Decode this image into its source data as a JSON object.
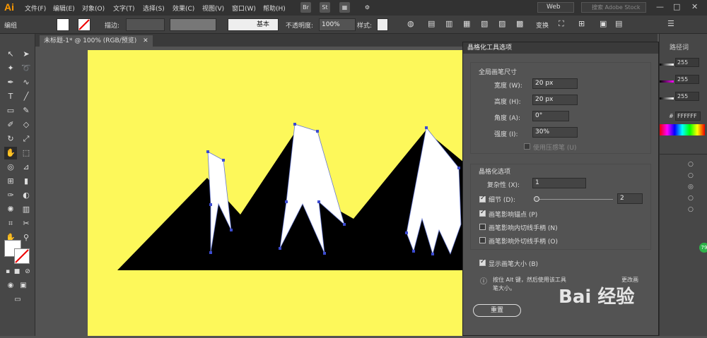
{
  "app": {
    "logo": "Ai"
  },
  "menubar": {
    "items": [
      "文件(F)",
      "编辑(E)",
      "对象(O)",
      "文字(T)",
      "选择(S)",
      "效果(C)",
      "视图(V)",
      "窗口(W)",
      "帮助(H)"
    ],
    "bridge": "Br",
    "stock": "St",
    "workspace": "Web",
    "search_placeholder": "搜索 Adobe Stock"
  },
  "controlbar": {
    "group_label": "编组",
    "stroke_label": "描边:",
    "brush_label": "基本",
    "opacity_label": "不透明度:",
    "opacity_value": "100%",
    "style_label": "样式:",
    "transform_label": "变换"
  },
  "document": {
    "tab_title": "未标题-1* @ 100% (RGB/预览)"
  },
  "dialog": {
    "title": "晶格化工具选项",
    "global_section": "全局画笔尺寸",
    "width_label": "宽度 (W):",
    "width_value": "20 px",
    "height_label": "高度 (H):",
    "height_value": "20 px",
    "angle_label": "角度 (A):",
    "angle_value": "0°",
    "intensity_label": "强度 (I):",
    "intensity_value": "30%",
    "pressure_label": "使用压感笔 (U)",
    "options_section": "晶格化选项",
    "complexity_label": "复杂性 (X):",
    "complexity_value": "1",
    "detail_label": "细节 (D):",
    "detail_value": "2",
    "anchor_label": "画笔影响锚点 (P)",
    "in_tangent_label": "画笔影响内切线手柄 (N)",
    "out_tangent_label": "画笔影响外切线手柄 (O)",
    "show_size_label": "显示画笔大小 (B)",
    "hint_text": "按住 Alt 键，然后使用该工具",
    "hint_text2": "笔大小。",
    "hint_tail": "更改画",
    "reset_label": "重置"
  },
  "right_panel": {
    "tab_label": "路径词",
    "values": [
      "255",
      "255",
      "255"
    ],
    "hex_label": "#",
    "hex_value": "FFFFFF",
    "badge": "79"
  },
  "watermark": "Bai 经验"
}
